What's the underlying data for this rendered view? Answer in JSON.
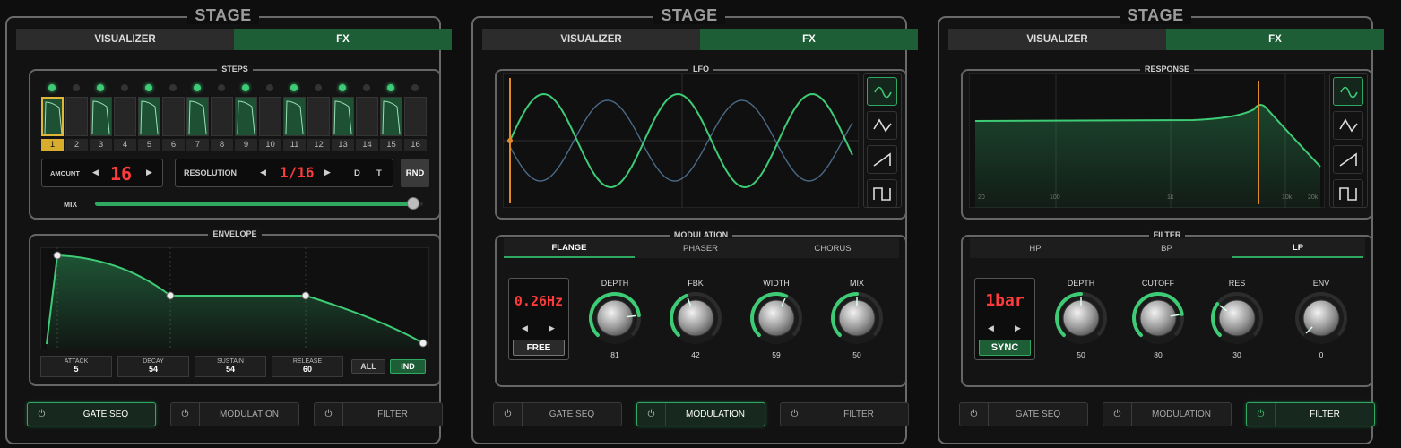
{
  "stage_title": "STAGE",
  "tabs": [
    "VISUALIZER",
    "FX"
  ],
  "footer": [
    "GATE SEQ",
    "MODULATION",
    "FILTER"
  ],
  "power_glyph": "⏻",
  "colors": {
    "accent": "#2fa862",
    "accent_dark": "#1d5e36",
    "display_red": "#ff3b3b",
    "playhead": "#e08a2a",
    "selected_step": "#d8ad2e"
  },
  "panel1": {
    "steps_label": "STEPS",
    "step_numbers": [
      "1",
      "2",
      "3",
      "4",
      "5",
      "6",
      "7",
      "8",
      "9",
      "10",
      "11",
      "12",
      "13",
      "14",
      "15",
      "16"
    ],
    "active_steps": [
      1,
      3,
      5,
      7,
      9,
      11,
      13,
      15
    ],
    "selected_step": "1",
    "amount_label": "AMOUNT",
    "amount_value": "16",
    "resolution_label": "RESOLUTION",
    "resolution_value": "1/16",
    "d_label": "D",
    "t_label": "T",
    "rnd_label": "RND",
    "mix_label": "MIX",
    "mix_level": 0.97,
    "envelope_label": "ENVELOPE",
    "env": {
      "attack_label": "ATTACK",
      "attack": "5",
      "decay_label": "DECAY",
      "decay": "54",
      "sustain_label": "SUSTAIN",
      "sustain": "54",
      "release_label": "RELEASE",
      "release": "60"
    },
    "all_label": "ALL",
    "ind_label": "IND",
    "active_footer": "GATE SEQ"
  },
  "panel2": {
    "lfo_label": "LFO",
    "modulation_label": "MODULATION",
    "mod_tabs": [
      "FLANGE",
      "PHASER",
      "CHORUS"
    ],
    "active_mod_tab": "FLANGE",
    "rate_value": "0.26Hz",
    "free_label": "FREE",
    "knobs": [
      {
        "label": "DEPTH",
        "value": "81"
      },
      {
        "label": "FBK",
        "value": "42"
      },
      {
        "label": "WIDTH",
        "value": "59"
      },
      {
        "label": "MIX",
        "value": "50"
      }
    ],
    "waveforms": [
      "sine-icon",
      "triangle-icon",
      "saw-icon",
      "square-icon"
    ],
    "active_waveform": "sine-icon",
    "active_footer": "MODULATION"
  },
  "panel3": {
    "response_label": "RESPONSE",
    "freq_ticks": [
      "20",
      "100",
      "1k",
      "10k",
      "20k"
    ],
    "filter_label": "FILTER",
    "filter_tabs": [
      "HP",
      "BP",
      "LP"
    ],
    "active_filter_tab": "LP",
    "rate_value": "1bar",
    "sync_label": "SYNC",
    "knobs": [
      {
        "label": "DEPTH",
        "value": "50"
      },
      {
        "label": "CUTOFF",
        "value": "80"
      },
      {
        "label": "RES",
        "value": "30"
      },
      {
        "label": "ENV",
        "value": "0"
      }
    ],
    "waveforms": [
      "sine-icon",
      "triangle-icon",
      "saw-icon",
      "square-icon"
    ],
    "active_waveform": "sine-icon",
    "active_footer": "FILTER"
  }
}
